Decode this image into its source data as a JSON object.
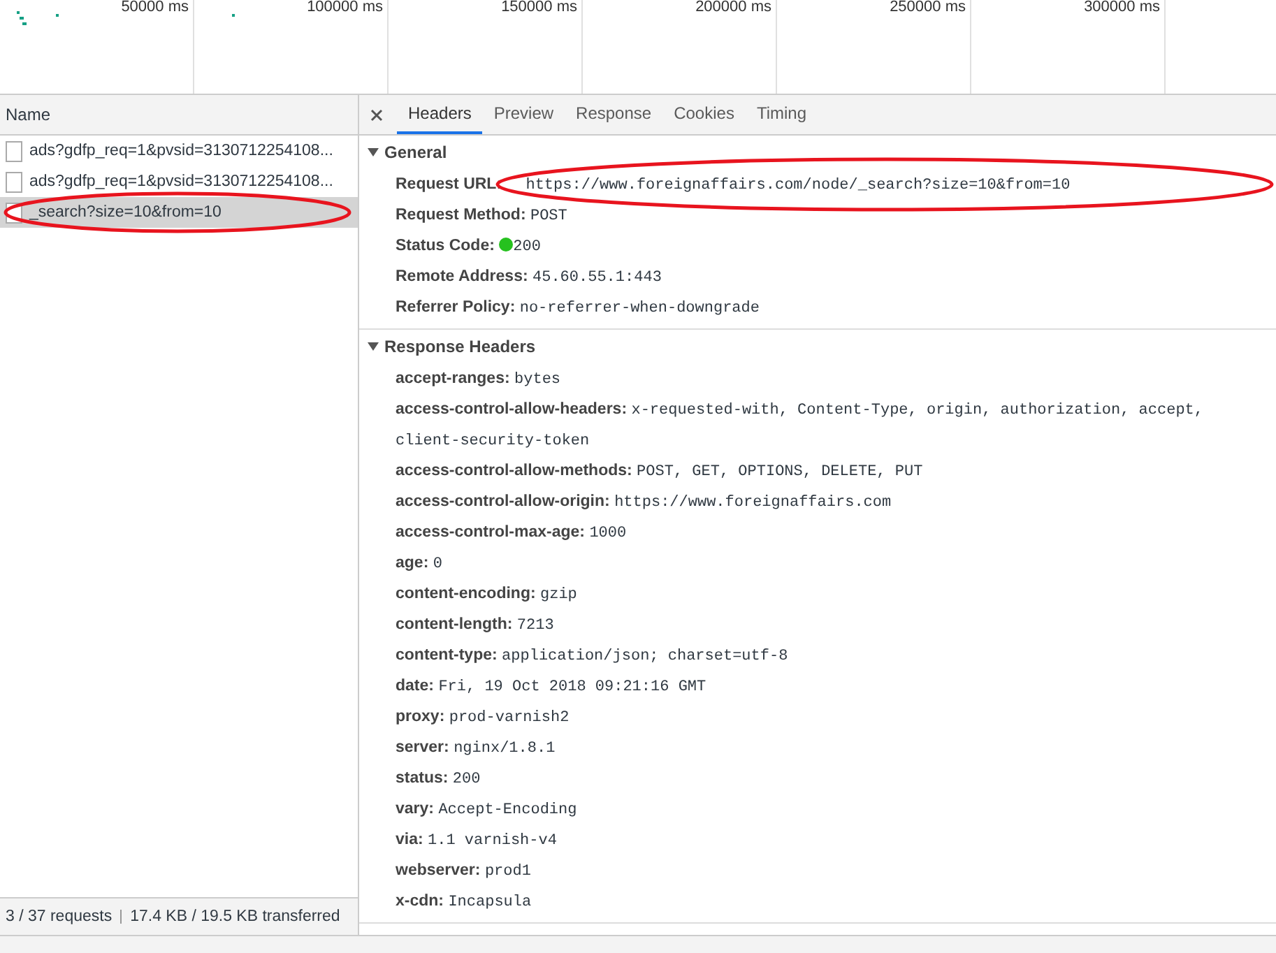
{
  "timeline": {
    "ticks": [
      "50000 ms",
      "100000 ms",
      "150000 ms",
      "200000 ms",
      "250000 ms",
      "300000 ms"
    ]
  },
  "requests": {
    "column": "Name",
    "items": [
      {
        "name": "ads?gdfp_req=1&pvsid=3130712254108...",
        "selected": false,
        "circled": false
      },
      {
        "name": "ads?gdfp_req=1&pvsid=3130712254108...",
        "selected": false,
        "circled": false
      },
      {
        "name": "_search?size=10&from=10",
        "selected": true,
        "circled": true
      }
    ]
  },
  "status_bar": {
    "requests": "3 / 37 requests",
    "transferred": "17.4 KB / 19.5 KB transferred"
  },
  "tabs": [
    {
      "label": "Headers",
      "selected": true
    },
    {
      "label": "Preview",
      "selected": false
    },
    {
      "label": "Response",
      "selected": false
    },
    {
      "label": "Cookies",
      "selected": false
    },
    {
      "label": "Timing",
      "selected": false
    }
  ],
  "sections": [
    {
      "title": "General",
      "expanded": true,
      "rows": [
        {
          "key": "Request URL:",
          "value": "https://www.foreignaffairs.com/node/_search?size=10&from=10",
          "circled": true
        },
        {
          "key": "Request Method:",
          "value": "POST",
          "circled": false
        },
        {
          "key": "Status Code:",
          "value": "200",
          "kind": "status",
          "circled": false
        },
        {
          "key": "Remote Address:",
          "value": "45.60.55.1:443",
          "circled": false
        },
        {
          "key": "Referrer Policy:",
          "value": "no-referrer-when-downgrade",
          "circled": false
        }
      ]
    },
    {
      "title": "Response Headers",
      "expanded": true,
      "rows": [
        {
          "key": "accept-ranges:",
          "value": "bytes"
        },
        {
          "key": "access-control-allow-headers:",
          "value": "x-requested-with, Content-Type, origin, authorization, accept, client-security-token"
        },
        {
          "key": "access-control-allow-methods:",
          "value": "POST, GET, OPTIONS, DELETE, PUT"
        },
        {
          "key": "access-control-allow-origin:",
          "value": "https://www.foreignaffairs.com"
        },
        {
          "key": "access-control-max-age:",
          "value": "1000"
        },
        {
          "key": "age:",
          "value": "0"
        },
        {
          "key": "content-encoding:",
          "value": "gzip"
        },
        {
          "key": "content-length:",
          "value": "7213"
        },
        {
          "key": "content-type:",
          "value": "application/json; charset=utf-8"
        },
        {
          "key": "date:",
          "value": "Fri, 19 Oct 2018 09:21:16 GMT"
        },
        {
          "key": "proxy:",
          "value": "prod-varnish2"
        },
        {
          "key": "server:",
          "value": "nginx/1.8.1"
        },
        {
          "key": "status:",
          "value": "200"
        },
        {
          "key": "vary:",
          "value": "Accept-Encoding"
        },
        {
          "key": "via:",
          "value": "1.1 varnish-v4"
        },
        {
          "key": "webserver:",
          "value": "prod1"
        },
        {
          "key": "x-cdn:",
          "value": "Incapsula"
        }
      ]
    }
  ]
}
